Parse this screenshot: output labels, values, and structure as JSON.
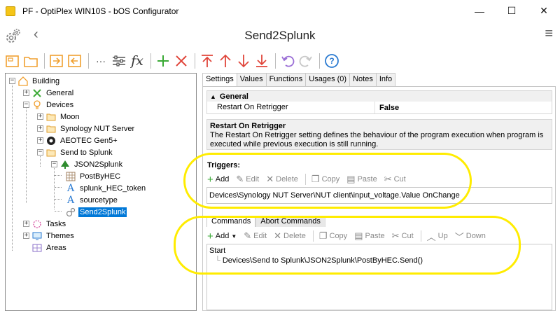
{
  "window": {
    "title": "PF - OptiPlex WIN10S - bOS Configurator",
    "minimize": "—",
    "maximize": "☐",
    "close": "✕"
  },
  "header": {
    "title": "Send2Splunk",
    "back": "‹",
    "menu": "≡"
  },
  "toolbar": {
    "buttons": [
      "folder-open",
      "folder",
      "import",
      "export",
      "more",
      "settings-sliders",
      "fx",
      "add",
      "delete",
      "move-top",
      "move-up",
      "move-down",
      "move-bottom",
      "undo",
      "redo",
      "help"
    ],
    "more_label": "···",
    "fx_label": "fx"
  },
  "tree": {
    "building": "Building",
    "general": "General",
    "devices": "Devices",
    "moon": "Moon",
    "synology": "Synology NUT Server",
    "aeotec": "AEOTEC Gen5+",
    "send_to_splunk": "Send to Splunk",
    "json2splunk": "JSON2Splunk",
    "postbyhec": "PostByHEC",
    "hec_token": "splunk_HEC_token",
    "sourcetype": "sourcetype",
    "send2splunk": "Send2Splunk",
    "tasks": "Tasks",
    "themes": "Themes",
    "areas": "Areas"
  },
  "tabs": [
    "Settings",
    "Values",
    "Functions",
    "Usages (0)",
    "Notes",
    "Info"
  ],
  "settings": {
    "category": "General",
    "property_name": "Restart On Retrigger",
    "property_value": "False",
    "description_title": "Restart On Retrigger",
    "description_text": "The Restart On Retrigger setting defines the behaviour of the program execution when program is executed while previous execution is still running."
  },
  "triggers": {
    "label": "Triggers:",
    "actions": {
      "add": "Add",
      "edit": "Edit",
      "delete": "Delete",
      "copy": "Copy",
      "paste": "Paste",
      "cut": "Cut"
    },
    "items": [
      "Devices\\Synology NUT Server\\NUT client\\input_voltage.Value OnChange"
    ]
  },
  "commands": {
    "tabs": [
      "Commands",
      "Abort Commands"
    ],
    "actions": {
      "add": "Add",
      "edit": "Edit",
      "delete": "Delete",
      "copy": "Copy",
      "paste": "Paste",
      "cut": "Cut",
      "up": "Up",
      "down": "Down"
    },
    "start": "Start",
    "items": [
      "Devices\\Send to Splunk\\JSON2Splunk\\PostByHEC.Send()"
    ]
  },
  "colors": {
    "selection": "#0078d7",
    "annotation": "#ffec00",
    "toolbar_orange": "#f0a030",
    "toolbar_green": "#3aa935",
    "toolbar_red": "#e0453a",
    "toolbar_blue": "#2a7ad1"
  }
}
